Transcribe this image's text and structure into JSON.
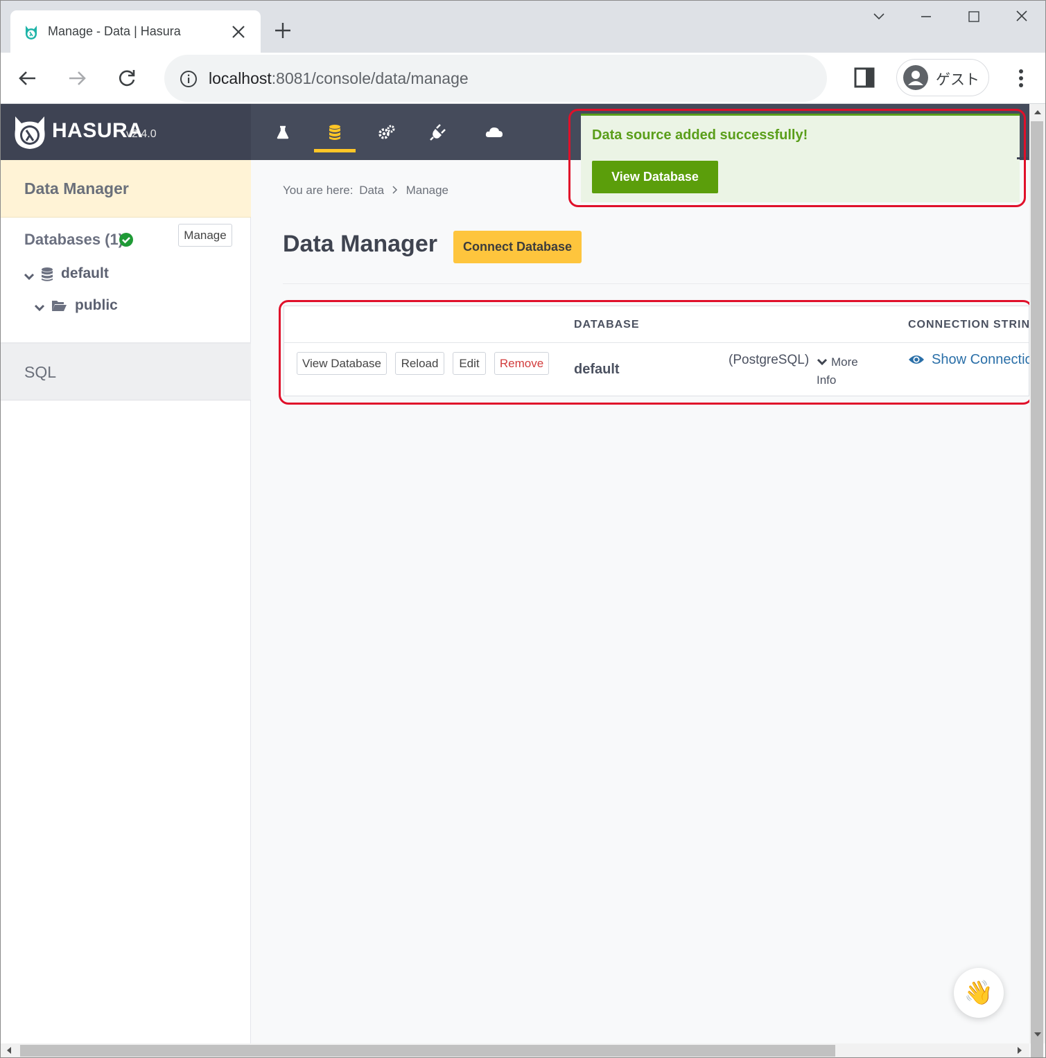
{
  "browser": {
    "tab_title": "Manage - Data | Hasura",
    "url_host": "localhost",
    "url_rest": ":8081/console/data/manage",
    "profile_label": "ゲスト"
  },
  "hasura": {
    "brand": "HASURA",
    "version": "v2.4.0",
    "nav_icons": [
      "flask-icon",
      "database-icon",
      "gears-icon",
      "plug-icon",
      "cloud-icon"
    ],
    "active_nav": "database-icon",
    "accent_color": "#ffc627"
  },
  "sidebar": {
    "header": "Data Manager",
    "databases_label": "Databases (1)",
    "manage_label": "Manage",
    "tree": [
      {
        "label": "default",
        "icon": "database-icon"
      },
      {
        "label": "public",
        "icon": "folder-open-icon"
      }
    ],
    "sql_label": "SQL"
  },
  "main": {
    "breadcrumb": [
      "You are here:",
      "Data",
      "Manage"
    ],
    "title": "Data Manager",
    "connect_label": "Connect Database",
    "table": {
      "headers": [
        "DATABASE",
        "CONNECTION STRIN"
      ],
      "row": {
        "actions": [
          "View Database",
          "Reload",
          "Edit",
          "Remove"
        ],
        "database": "default",
        "type": "(PostgreSQL)",
        "more_info": "More Info",
        "show_connection": "Show Connectio"
      }
    }
  },
  "toast": {
    "message": "Data source added successfully!",
    "button": "View Database",
    "color": "#5a9e1a"
  }
}
